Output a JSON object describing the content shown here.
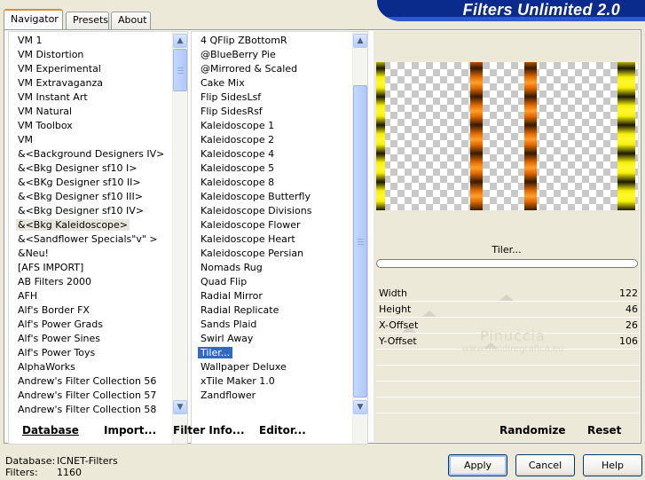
{
  "tabs": [
    "Navigator",
    "Presets",
    "About"
  ],
  "banner_title": "Filters Unlimited 2.0",
  "categories": [
    "VM 1",
    "VM Distortion",
    "VM Experimental",
    "VM Extravaganza",
    "VM Instant Art",
    "VM Natural",
    "VM Toolbox",
    "VM",
    "&<Background Designers IV>",
    "&<Bkg Designer sf10 I>",
    "&<BKg Designer sf10 II>",
    "&<Bkg Designer sf10 III>",
    "&<Bkg Designer sf10 IV>",
    "&<Bkg Kaleidoscope>",
    "&<Sandflower Specials\"v\" >",
    "&Neu!",
    "[AFS IMPORT]",
    "AB Filters 2000",
    "AFH",
    "Alf's Border FX",
    "Alf's Power Grads",
    "Alf's Power Sines",
    "Alf's Power Toys",
    "AlphaWorks",
    "Andrew's Filter Collection 56",
    "Andrew's Filter Collection 57",
    "Andrew's Filter Collection 58"
  ],
  "selected_category": "&<Bkg Kaleidoscope>",
  "filters": [
    "4 QFlip ZBottomR",
    "@BlueBerry Pie",
    "@Mirrored & Scaled",
    "Cake Mix",
    "Flip SidesLsf",
    "Flip SidesRsf",
    "Kaleidoscope 1",
    "Kaleidoscope 2",
    "Kaleidoscope 4",
    "Kaleidoscope 5",
    "Kaleidoscope 8",
    "Kaleidoscope Butterfly",
    "Kaleidoscope Divisions",
    "Kaleidoscope Flower",
    "Kaleidoscope Heart",
    "Kaleidoscope Persian",
    "Nomads Rug",
    "Quad Flip",
    "Radial Mirror",
    "Radial Replicate",
    "Sands Plaid",
    "Swirl Away",
    "Tiler...",
    "Wallpaper Deluxe",
    "xTile Maker 1.0",
    "Zandflower"
  ],
  "selected_filter": "Tiler...",
  "current_filter_label": "Tiler...",
  "progress": 0,
  "params": [
    {
      "name": "Width",
      "value": "122",
      "level": 0.48
    },
    {
      "name": "Height",
      "value": "46",
      "level": 0.18
    },
    {
      "name": "X-Offset",
      "value": "26",
      "level": 0.1
    },
    {
      "name": "Y-Offset",
      "value": "106",
      "level": 0.42
    }
  ],
  "watermark": {
    "name": "Pinuccia",
    "url": "www.maidiregrafica.eu"
  },
  "toolbar": {
    "database": "Database",
    "import": "Import...",
    "filter_info": "Filter Info...",
    "editor": "Editor...",
    "randomize": "Randomize",
    "reset": "Reset"
  },
  "status": {
    "database_label": "Database:",
    "database_value": "ICNET-Filters",
    "filters_label": "Filters:",
    "filters_value": "1160"
  },
  "buttons": {
    "apply": "Apply",
    "cancel": "Cancel",
    "help": "Help"
  },
  "colors": {
    "accent": "#316ac5",
    "banner": "#0a2a8c"
  }
}
